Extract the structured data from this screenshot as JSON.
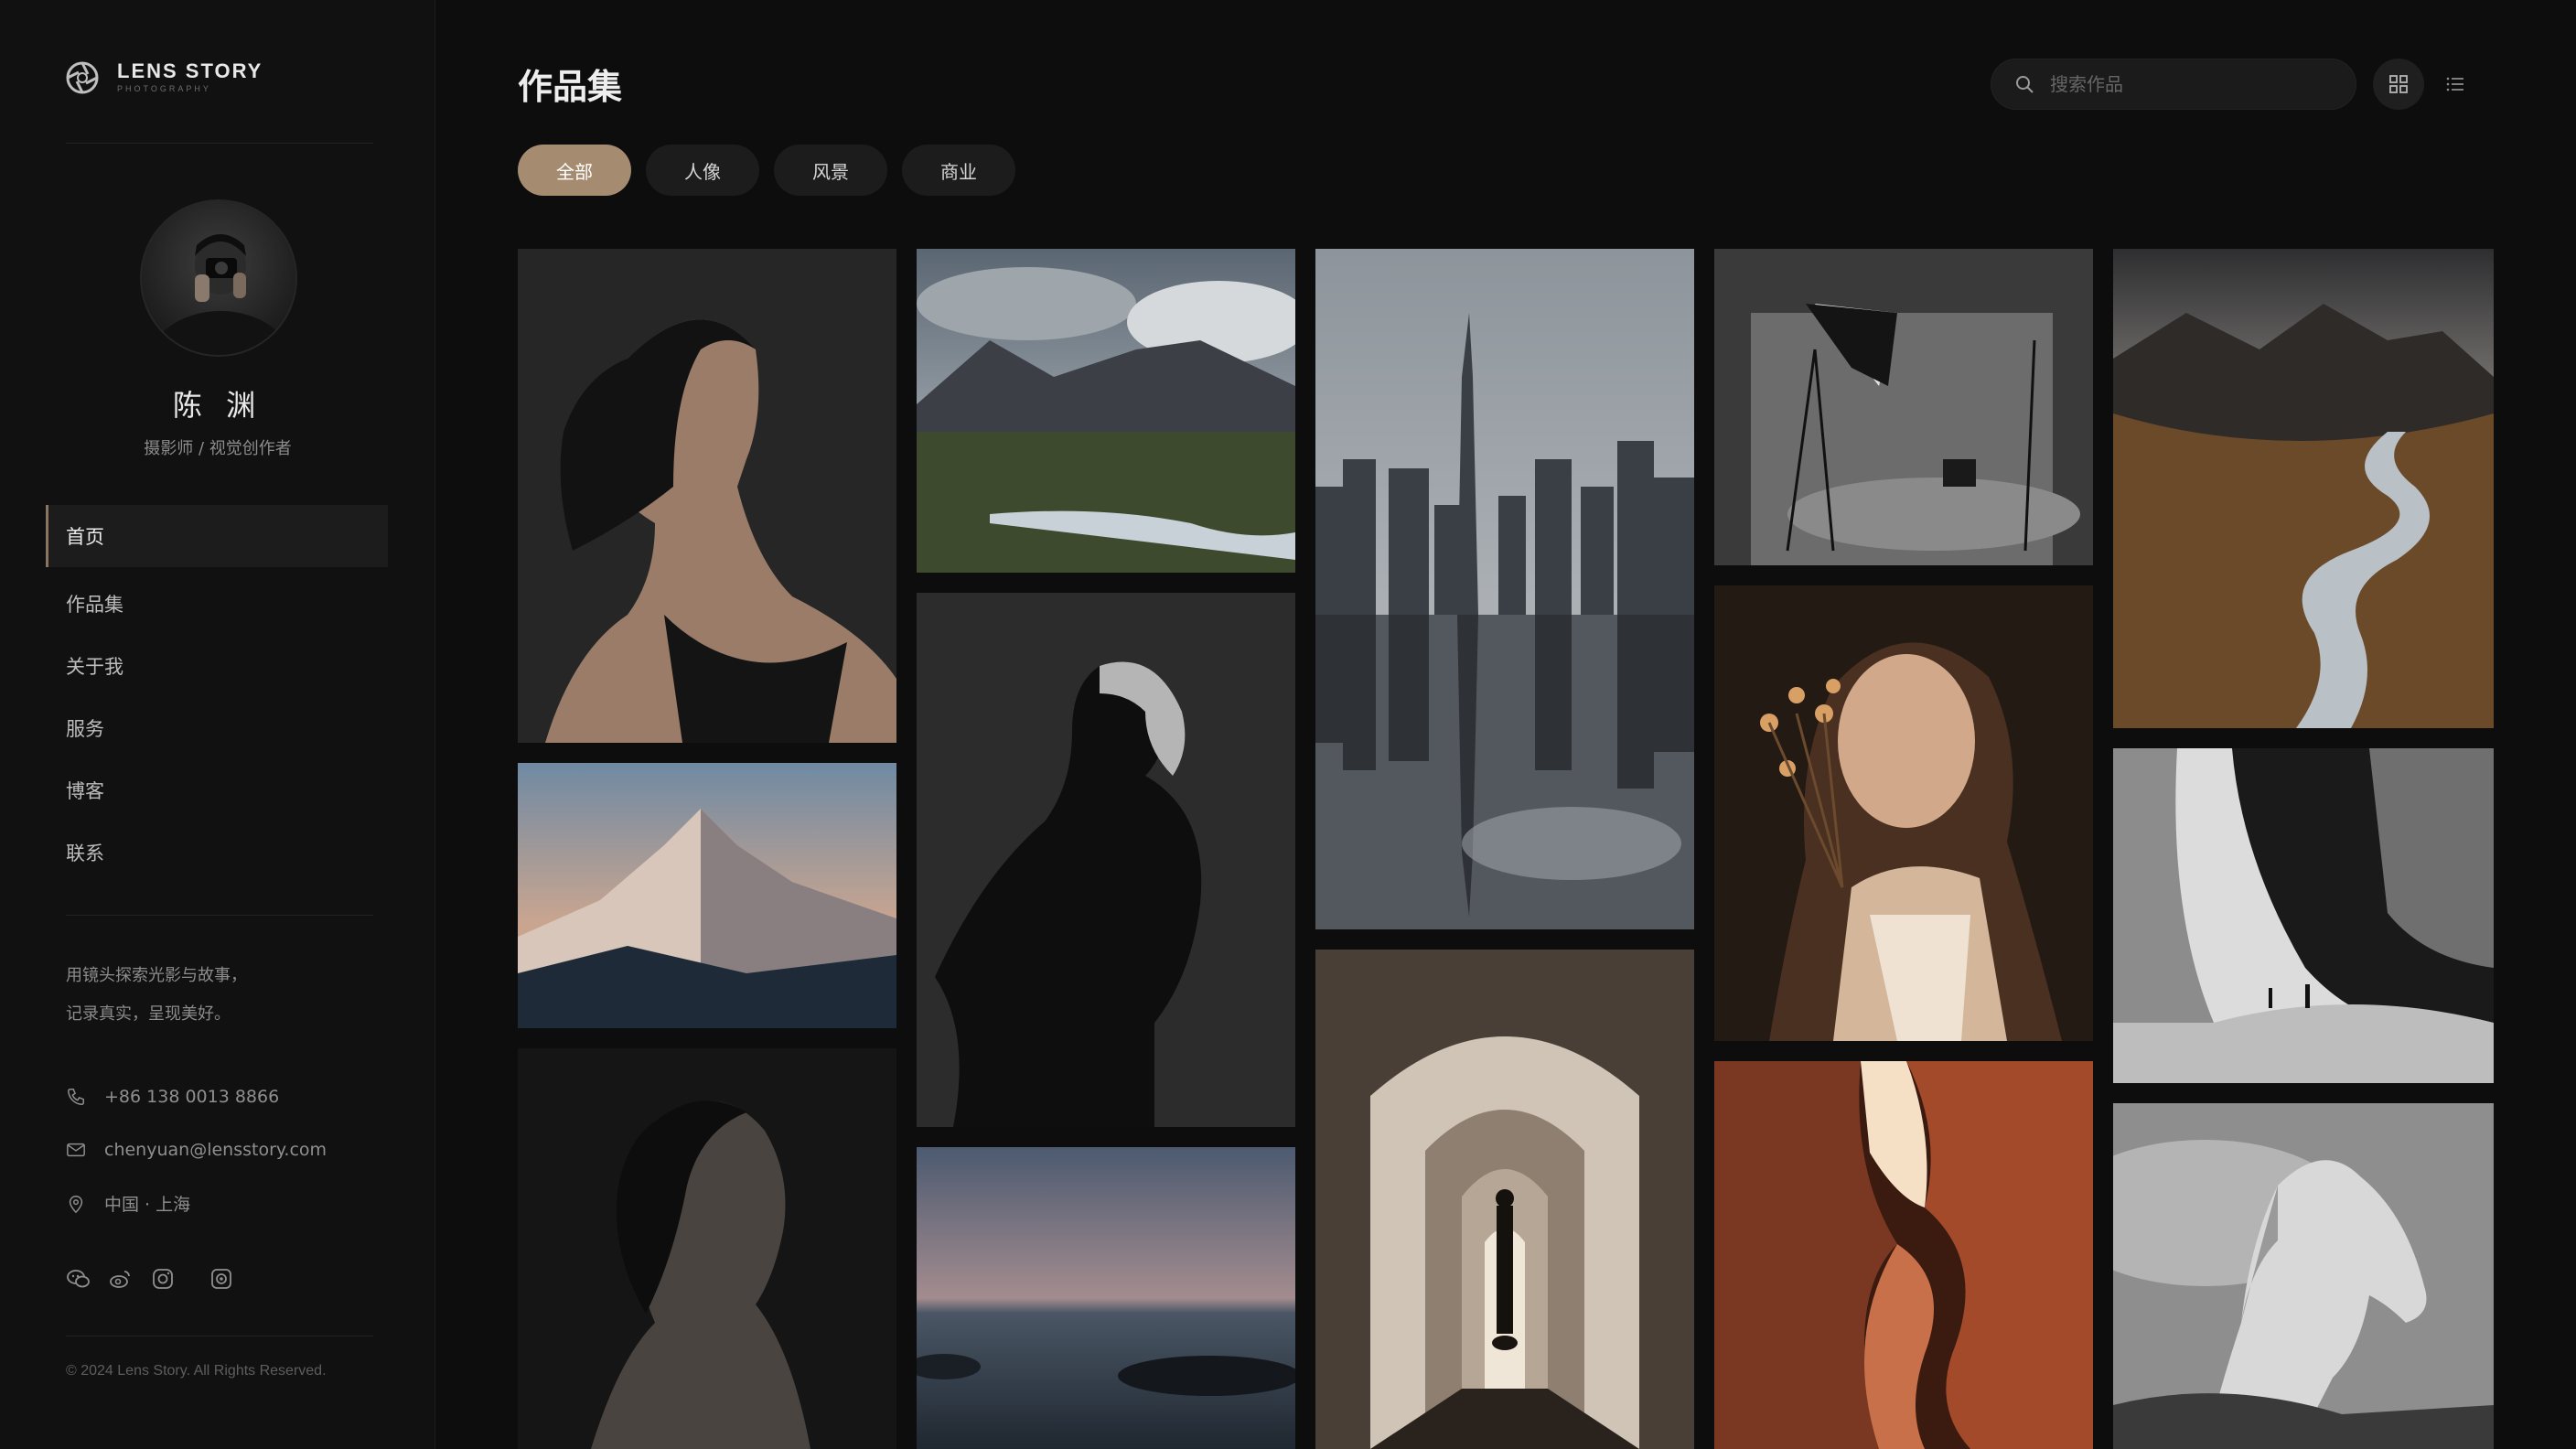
{
  "brand": {
    "name": "LENS STORY",
    "tagline": "PHOTOGRAPHY"
  },
  "profile": {
    "name": "陈 渊",
    "title": "摄影师 / 视觉创作者"
  },
  "nav": [
    {
      "label": "首页",
      "active": true
    },
    {
      "label": "作品集",
      "active": false
    },
    {
      "label": "关于我",
      "active": false
    },
    {
      "label": "服务",
      "active": false
    },
    {
      "label": "博客",
      "active": false
    },
    {
      "label": "联系",
      "active": false
    }
  ],
  "slogan": {
    "line1": "用镜头探索光影与故事，",
    "line2": "记录真实，呈现美好。"
  },
  "contact": {
    "phone": "+86 138 0013 8866",
    "email": "chenyuan@lensstory.com",
    "location": "中国 · 上海"
  },
  "socials": [
    "wechat-icon",
    "weibo-icon",
    "instagram-icon",
    "camera-app-icon"
  ],
  "copyright": "© 2024 Lens Story. All Rights Reserved.",
  "main": {
    "title": "作品集",
    "search_placeholder": "搜索作品",
    "view_modes": [
      "grid",
      "list"
    ],
    "active_view": "grid",
    "filters": [
      {
        "label": "全部",
        "active": true
      },
      {
        "label": "人像",
        "active": false
      },
      {
        "label": "风景",
        "active": false
      },
      {
        "label": "商业",
        "active": false
      }
    ]
  },
  "gallery": [
    {
      "name": "portrait-woman-profile"
    },
    {
      "name": "snowy-mountain-sunset"
    },
    {
      "name": "portrait-woman-looking-up"
    },
    {
      "name": "valley-lake-clouds"
    },
    {
      "name": "bw-woman-pose"
    },
    {
      "name": "sea-twilight"
    },
    {
      "name": "city-skyline-reflection"
    },
    {
      "name": "arched-corridor-figure"
    },
    {
      "name": "studio-lights-chair"
    },
    {
      "name": "woman-with-flowers"
    },
    {
      "name": "antelope-canyon"
    },
    {
      "name": "river-valley-mountains"
    },
    {
      "name": "concrete-architecture"
    },
    {
      "name": "white-horse-fog"
    }
  ],
  "colors": {
    "accent": "#a58c70",
    "background": "#0d0d0d",
    "sidebar": "#111111"
  }
}
